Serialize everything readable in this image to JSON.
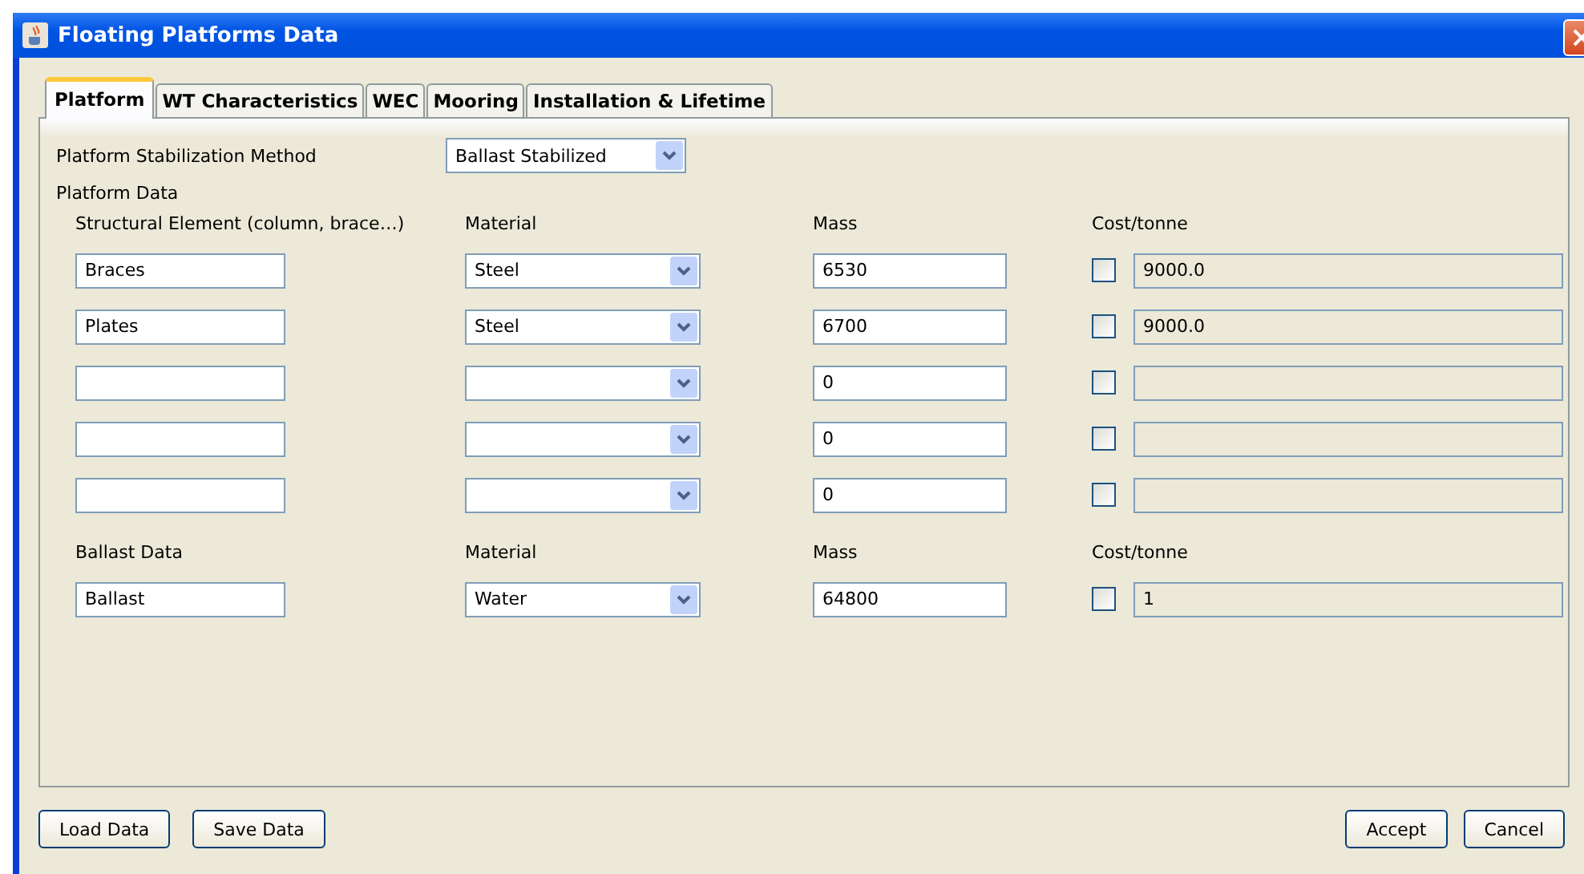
{
  "window": {
    "title": "Floating Platforms Data"
  },
  "tabs": [
    {
      "label": "Platform",
      "selected": true
    },
    {
      "label": "WT Characteristics",
      "selected": false
    },
    {
      "label": "WEC",
      "selected": false
    },
    {
      "label": "Mooring",
      "selected": false
    },
    {
      "label": "Installation & Lifetime",
      "selected": false
    }
  ],
  "stabilization": {
    "label": "Platform Stabilization Method",
    "value": "Ballast Stabilized"
  },
  "platform_data": {
    "title": "Platform Data",
    "columns": [
      "Structural Element (column, brace…)",
      "Material",
      "Mass",
      "Cost/tonne"
    ],
    "rows": [
      {
        "element": "Braces",
        "material": "Steel",
        "mass": "6530",
        "checked": false,
        "cost": "9000.0"
      },
      {
        "element": "Plates",
        "material": "Steel",
        "mass": "6700",
        "checked": false,
        "cost": "9000.0"
      },
      {
        "material": "",
        "mass": "0",
        "checked": false
      },
      {
        "material": "",
        "mass": "0",
        "checked": false
      },
      {
        "material": "",
        "mass": "0",
        "checked": false
      }
    ]
  },
  "ballast_data": {
    "columns": [
      "Ballast Data",
      "Material",
      "Mass",
      "Cost/tonne"
    ],
    "rows": [
      {
        "element": "Ballast",
        "material": "Water",
        "mass": "64800",
        "checked": false,
        "cost": "1"
      }
    ]
  },
  "buttons_left": [
    "Load Data",
    "Save Data"
  ],
  "buttons_right": [
    "Accept",
    "Cancel"
  ]
}
